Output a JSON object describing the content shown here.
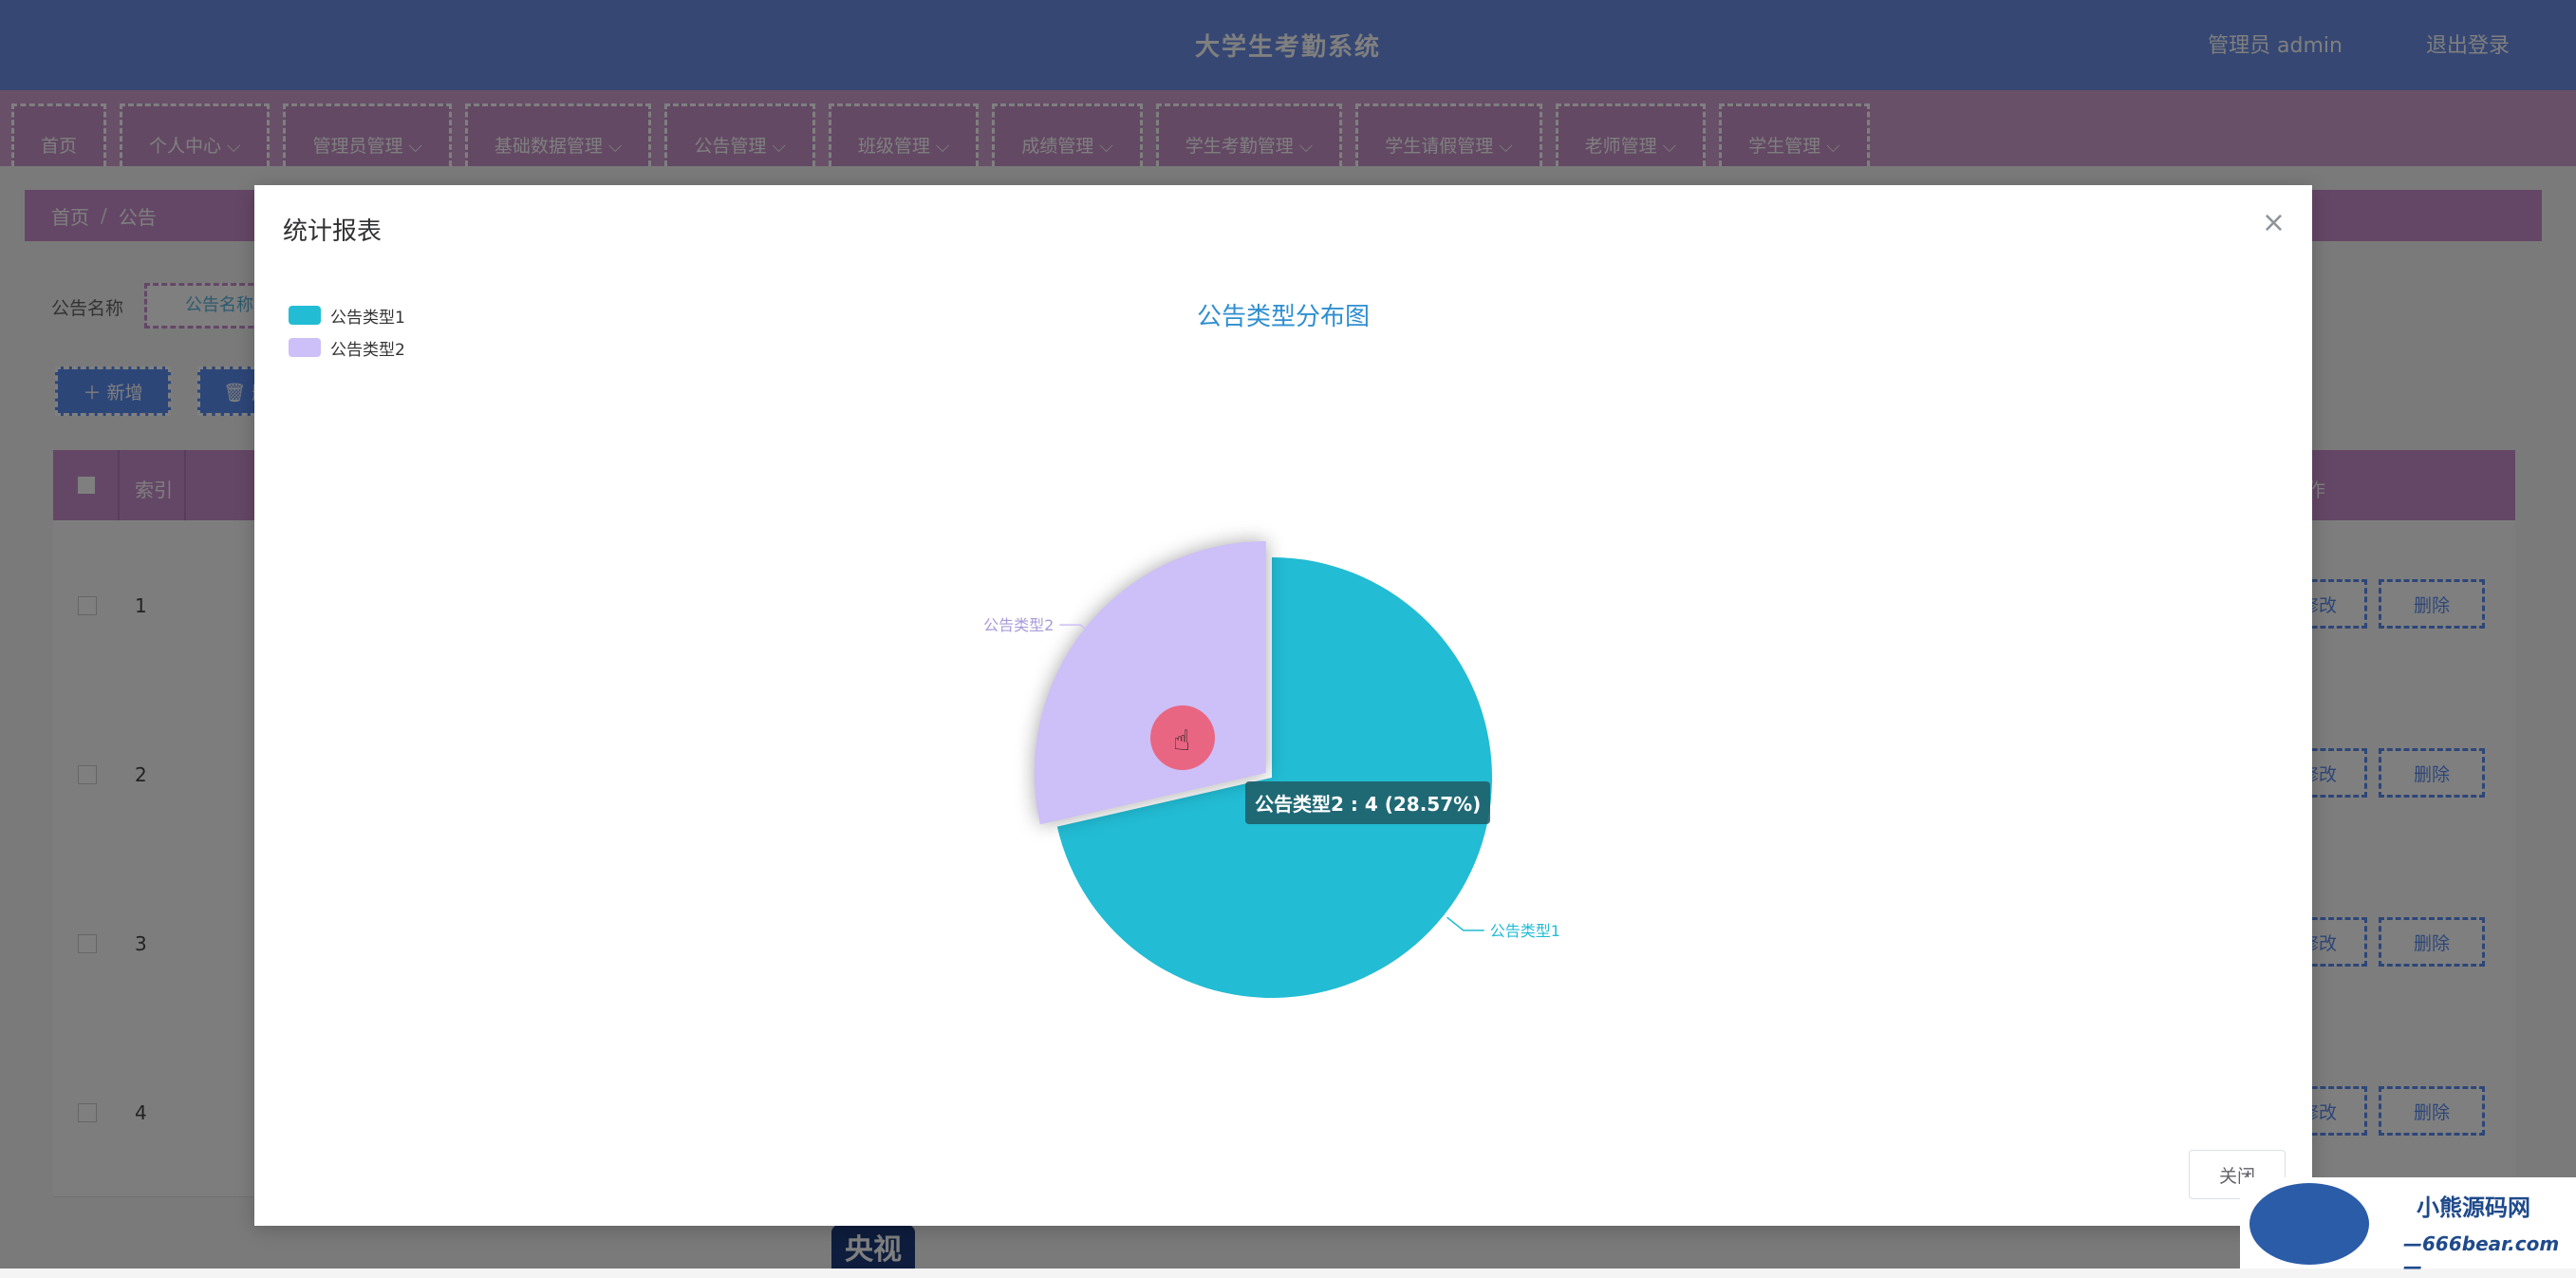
{
  "header": {
    "title": "大学生考勤系统",
    "user": "管理员 admin",
    "logout": "退出登录"
  },
  "nav": [
    {
      "label": "首页"
    },
    {
      "label": "个人中心 ⌵"
    },
    {
      "label": "管理员管理 ⌵"
    },
    {
      "label": "基础数据管理 ⌵"
    },
    {
      "label": "公告管理 ⌵"
    },
    {
      "label": "班级管理 ⌵"
    },
    {
      "label": "成绩管理 ⌵"
    },
    {
      "label": "学生考勤管理 ⌵"
    },
    {
      "label": "学生请假管理 ⌵"
    },
    {
      "label": "老师管理 ⌵"
    },
    {
      "label": "学生管理 ⌵"
    }
  ],
  "breadcrumb": {
    "home": "首页",
    "sep": "/",
    "current": "公告"
  },
  "search": {
    "label": "公告名称",
    "placeholder": "公告名称"
  },
  "toolbar": {
    "add_label": "＋ 新增",
    "delete_label": "🗑 删"
  },
  "table": {
    "headers": {
      "index": "索引",
      "ops": "作"
    },
    "rows": [
      {
        "index": "1",
        "edit": "修改",
        "delete": "删除"
      },
      {
        "index": "2",
        "edit": "修改",
        "delete": "删除"
      },
      {
        "index": "3",
        "edit": "修改",
        "delete": "删除"
      },
      {
        "index": "4",
        "edit": "修改",
        "delete": "删除"
      }
    ]
  },
  "bg_logo": "央视",
  "modal": {
    "title": "统计报表",
    "close_icon": "×",
    "footer_close": "关闭"
  },
  "chart_data": {
    "type": "pie",
    "title": "公告类型分布图",
    "slices": [
      {
        "name": "公告类型1",
        "value": 10,
        "color": "#22bcd4"
      },
      {
        "name": "公告类型2",
        "value": 4,
        "color": "#cdbff7"
      }
    ],
    "highlighted": "公告类型2",
    "legend_position": "top-left",
    "tooltip": "公告类型2 : 4 (28.57%)"
  },
  "watermark": {
    "line1": "小熊源码网",
    "line2": "—666bear.com—"
  }
}
